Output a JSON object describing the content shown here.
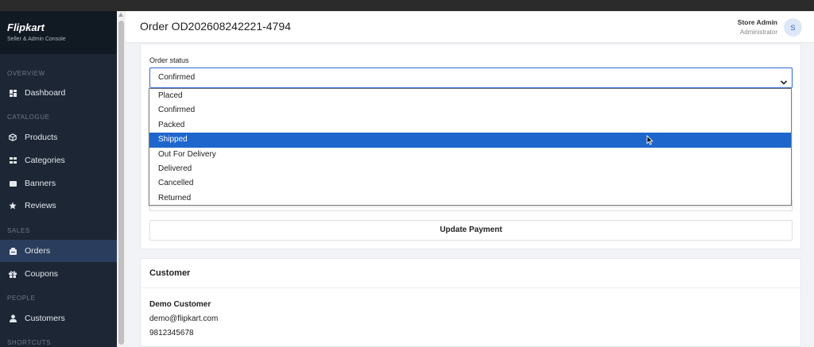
{
  "brand": {
    "name": "Flipkart",
    "subtitle": "Seller & Admin Console"
  },
  "sidebar": {
    "sections": [
      "OVERVIEW",
      "CATALOGUE",
      "SALES",
      "PEOPLE",
      "SHORTCUTS"
    ],
    "items": [
      {
        "label": "Dashboard",
        "icon": "dashboard-icon"
      },
      {
        "label": "Products",
        "icon": "box-icon"
      },
      {
        "label": "Categories",
        "icon": "grid-icon"
      },
      {
        "label": "Banners",
        "icon": "banner-icon"
      },
      {
        "label": "Reviews",
        "icon": "star-icon"
      },
      {
        "label": "Orders",
        "icon": "orders-icon",
        "active": true
      },
      {
        "label": "Coupons",
        "icon": "gift-icon"
      },
      {
        "label": "Customers",
        "icon": "user-icon"
      }
    ]
  },
  "header": {
    "title": "Order OD202608242221-4794",
    "user_name": "Store Admin",
    "user_role": "Administrator",
    "avatar_initial": "S"
  },
  "order_status": {
    "label": "Order status",
    "value": "Confirmed",
    "options": [
      "Placed",
      "Confirmed",
      "Packed",
      "Shipped",
      "Out For Delivery",
      "Delivered",
      "Cancelled",
      "Returned"
    ],
    "highlighted": "Shipped"
  },
  "payment": {
    "update_label": "Update Payment"
  },
  "customer": {
    "title": "Customer",
    "name": "Demo Customer",
    "email": "demo@flipkart.com",
    "phone": "9812345678"
  },
  "colors": {
    "sidebar_bg": "#1c2634",
    "active_item": "#2a3d5c",
    "accent": "#1f66cc"
  }
}
